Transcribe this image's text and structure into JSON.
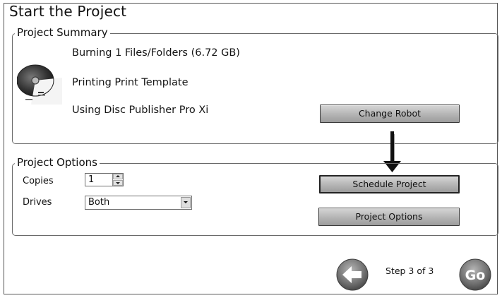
{
  "title": "Start the Project",
  "summary": {
    "legend": "Project Summary",
    "lines": [
      "Burning 1 Files/Folders (6.72 GB)",
      "Printing Print Template",
      "Using Disc Publisher Pro Xi"
    ],
    "change_robot_label": "Change Robot"
  },
  "options": {
    "legend": "Project Options",
    "copies_label": "Copies",
    "copies_value": "1",
    "drives_label": "Drives",
    "drives_value": "Both",
    "schedule_label": "Schedule Project",
    "project_options_label": "Project Options"
  },
  "footer": {
    "step_text": "Step 3 of 3",
    "go_label": "Go"
  },
  "icons": {
    "back": "back-arrow-icon",
    "go": "go-icon",
    "disc": "disc-thumbnail-icon",
    "pointer": "down-arrow-icon"
  }
}
